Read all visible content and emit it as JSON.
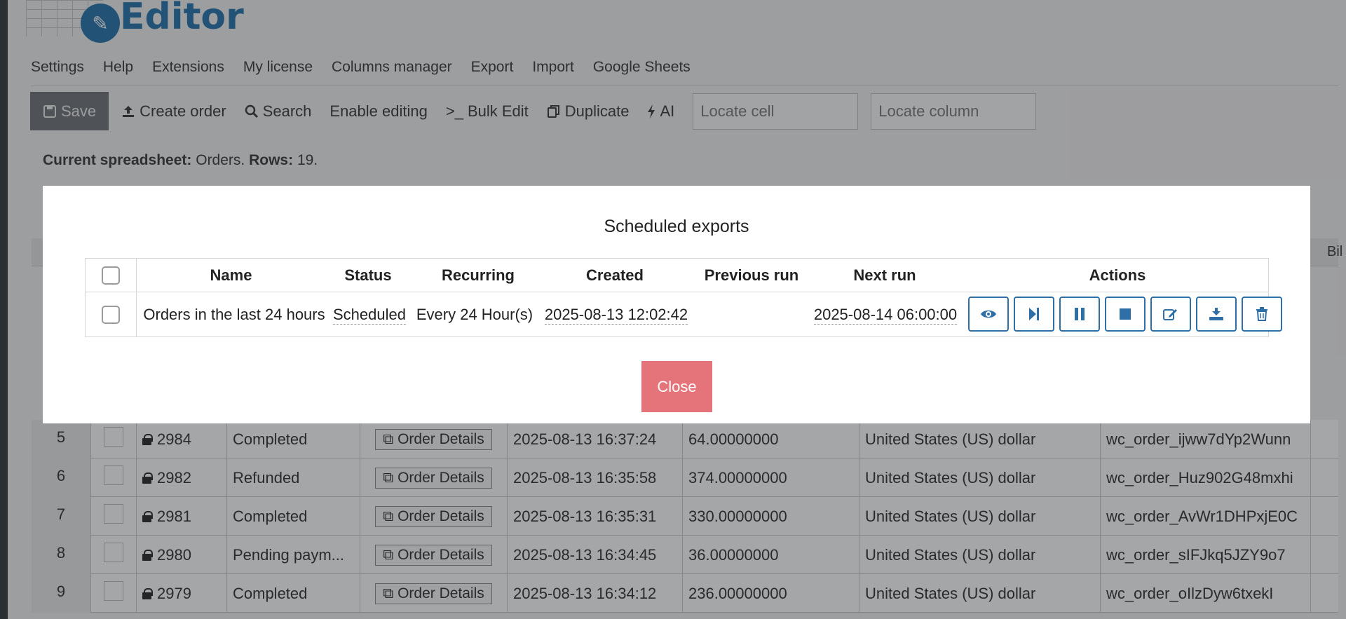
{
  "app": {
    "logo_text": "Editor"
  },
  "menu": [
    "Settings",
    "Help",
    "Extensions",
    "My license",
    "Columns manager",
    "Export",
    "Import",
    "Google Sheets"
  ],
  "toolbar": {
    "save": "Save",
    "create_order": "Create order",
    "search": "Search",
    "enable_editing": "Enable editing",
    "bulk_edit": "Bulk Edit",
    "duplicate": "Duplicate",
    "ai": "AI",
    "locate_cell_placeholder": "Locate cell",
    "locate_column_placeholder": "Locate column"
  },
  "sheet_info": {
    "label": "Current spreadsheet:",
    "name": "Orders.",
    "rows_label": "Rows:",
    "rows": "19."
  },
  "sheet_header_partial": "Bil",
  "rows": [
    {
      "num": "5",
      "id": "2984",
      "status": "Completed",
      "details": "Order Details",
      "date": "2025-08-13 16:37:24",
      "total": "64.00000000",
      "currency": "United States (US) dollar",
      "key": "wc_order_ijww7dYp2Wunn"
    },
    {
      "num": "6",
      "id": "2982",
      "status": "Refunded",
      "details": "Order Details",
      "date": "2025-08-13 16:35:58",
      "total": "374.00000000",
      "currency": "United States (US) dollar",
      "key": "wc_order_Huz902G48mxhi"
    },
    {
      "num": "7",
      "id": "2981",
      "status": "Completed",
      "details": "Order Details",
      "date": "2025-08-13 16:35:31",
      "total": "330.00000000",
      "currency": "United States (US) dollar",
      "key": "wc_order_AvWr1DHPxjE0C"
    },
    {
      "num": "8",
      "id": "2980",
      "status": "Pending paym...",
      "details": "Order Details",
      "date": "2025-08-13 16:34:45",
      "total": "36.00000000",
      "currency": "United States (US) dollar",
      "key": "wc_order_sIFJkq5JZY9o7"
    },
    {
      "num": "9",
      "id": "2979",
      "status": "Completed",
      "details": "Order Details",
      "date": "2025-08-13 16:34:12",
      "total": "236.00000000",
      "currency": "United States (US) dollar",
      "key": "wc_order_oIlzDyw6txekI"
    }
  ],
  "modal": {
    "title": "Scheduled exports",
    "columns": {
      "name": "Name",
      "status": "Status",
      "recurring": "Recurring",
      "created": "Created",
      "previous_run": "Previous run",
      "next_run": "Next run",
      "actions": "Actions"
    },
    "exports": [
      {
        "name": "Orders in the last 24 hours",
        "status": "Scheduled",
        "recurring": "Every 24 Hour(s)",
        "created": "2025-08-13 12:02:42",
        "previous_run": "",
        "next_run": "2025-08-14 06:00:00"
      }
    ],
    "action_icons": [
      "eye-icon",
      "run-next-icon",
      "pause-icon",
      "stop-icon",
      "edit-icon",
      "download-icon",
      "trash-icon"
    ],
    "close": "Close"
  },
  "colors": {
    "accent": "#1e6ea8",
    "action_border": "#2f6fa8",
    "close_button": "#e5737a",
    "save_button": "#6b6e73"
  }
}
